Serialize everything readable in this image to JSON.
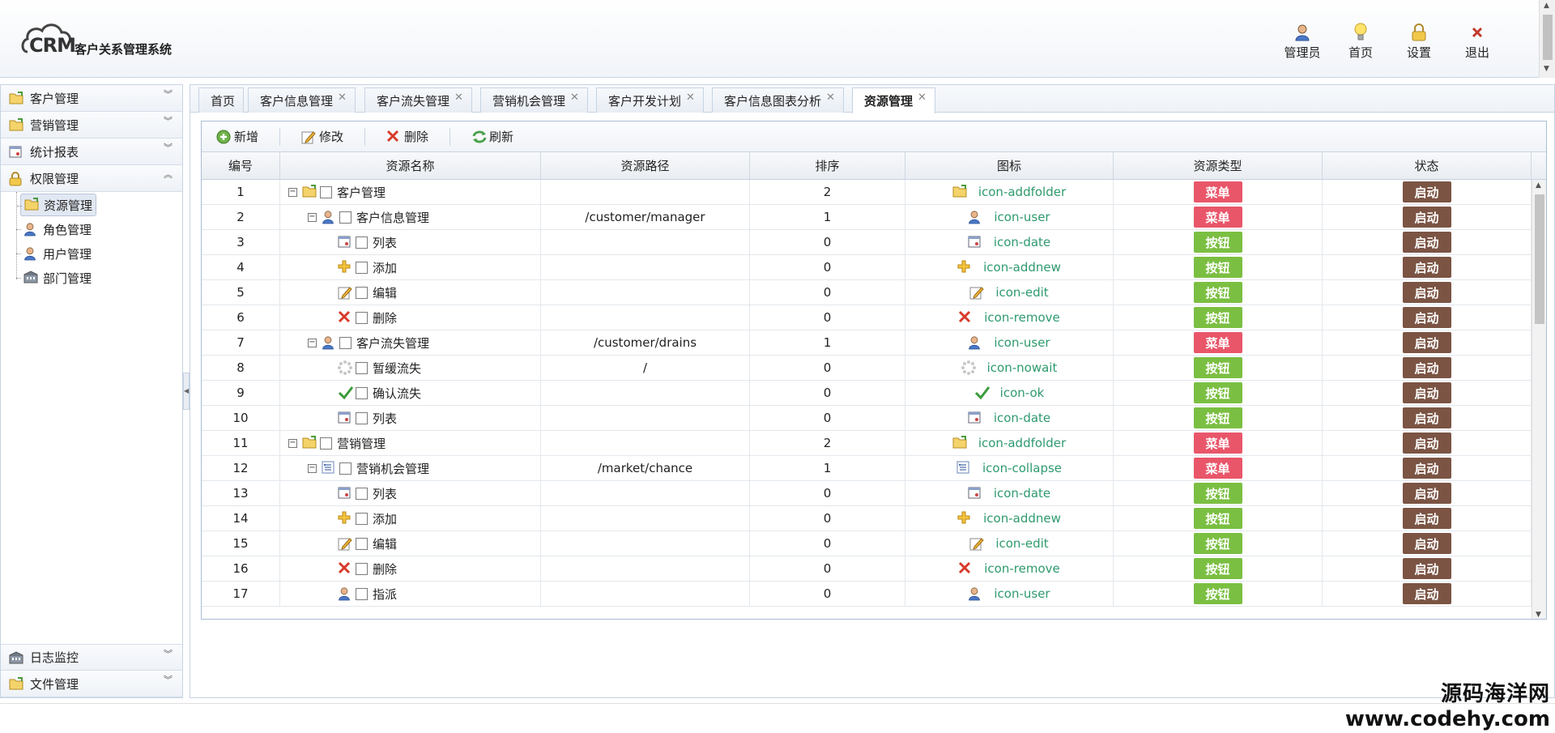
{
  "header": {
    "logo_text": "CRM",
    "title": "客户关系管理系统",
    "nav": [
      {
        "label": "管理员",
        "icon": "user-icon"
      },
      {
        "label": "首页",
        "icon": "lightbulb-icon"
      },
      {
        "label": "设置",
        "icon": "lock-icon"
      },
      {
        "label": "退出",
        "icon": "close-icon"
      }
    ]
  },
  "sidebar": {
    "sections": [
      {
        "label": "客户管理",
        "icon": "folder-icon"
      },
      {
        "label": "营销管理",
        "icon": "folder-icon"
      },
      {
        "label": "统计报表",
        "icon": "date-icon"
      },
      {
        "label": "权限管理",
        "icon": "lock-icon"
      }
    ],
    "sub_items": [
      {
        "label": "资源管理",
        "icon": "folder-icon"
      },
      {
        "label": "角色管理",
        "icon": "user-icon"
      },
      {
        "label": "用户管理",
        "icon": "user-icon"
      },
      {
        "label": "部门管理",
        "icon": "building-icon"
      }
    ],
    "bottom_sections": [
      {
        "label": "日志监控",
        "icon": "building-icon"
      },
      {
        "label": "文件管理",
        "icon": "folder-icon"
      }
    ]
  },
  "tabs": [
    {
      "label": "首页",
      "closable": false
    },
    {
      "label": "客户信息管理",
      "closable": true
    },
    {
      "label": "客户流失管理",
      "closable": true
    },
    {
      "label": "营销机会管理",
      "closable": true
    },
    {
      "label": "客户开发计划",
      "closable": true
    },
    {
      "label": "客户信息图表分析",
      "closable": true
    },
    {
      "label": "资源管理",
      "closable": true,
      "active": true
    }
  ],
  "toolbar": {
    "add": "新增",
    "edit": "修改",
    "delete": "删除",
    "refresh": "刷新"
  },
  "table": {
    "columns": [
      "编号",
      "资源名称",
      "资源路径",
      "排序",
      "图标",
      "资源类型",
      "状态"
    ],
    "rows": [
      {
        "id": "1",
        "name": "客户管理",
        "level": 0,
        "toggle": "⊟",
        "icon": "addfolder",
        "path": "",
        "sort": "2",
        "icon_name": "icon-addfolder",
        "type": "菜单",
        "status": "启动"
      },
      {
        "id": "2",
        "name": "客户信息管理",
        "level": 1,
        "toggle": "⊟",
        "icon": "user",
        "path": "/customer/manager",
        "sort": "1",
        "icon_name": "icon-user",
        "type": "菜单",
        "status": "启动"
      },
      {
        "id": "3",
        "name": "列表",
        "level": 2,
        "toggle": "",
        "icon": "date",
        "path": "",
        "sort": "0",
        "icon_name": "icon-date",
        "type": "按钮",
        "status": "启动"
      },
      {
        "id": "4",
        "name": "添加",
        "level": 2,
        "toggle": "",
        "icon": "addnew",
        "path": "",
        "sort": "0",
        "icon_name": "icon-addnew",
        "type": "按钮",
        "status": "启动"
      },
      {
        "id": "5",
        "name": "编辑",
        "level": 2,
        "toggle": "",
        "icon": "edit",
        "path": "",
        "sort": "0",
        "icon_name": "icon-edit",
        "type": "按钮",
        "status": "启动"
      },
      {
        "id": "6",
        "name": "删除",
        "level": 2,
        "toggle": "",
        "icon": "remove",
        "path": "",
        "sort": "0",
        "icon_name": "icon-remove",
        "type": "按钮",
        "status": "启动"
      },
      {
        "id": "7",
        "name": "客户流失管理",
        "level": 1,
        "toggle": "⊟",
        "icon": "user",
        "path": "/customer/drains",
        "sort": "1",
        "icon_name": "icon-user",
        "type": "菜单",
        "status": "启动"
      },
      {
        "id": "8",
        "name": "暂缓流失",
        "level": 2,
        "toggle": "",
        "icon": "nowait",
        "path": "/",
        "sort": "0",
        "icon_name": "icon-nowait",
        "type": "按钮",
        "status": "启动"
      },
      {
        "id": "9",
        "name": "确认流失",
        "level": 2,
        "toggle": "",
        "icon": "ok",
        "path": "",
        "sort": "0",
        "icon_name": "icon-ok",
        "type": "按钮",
        "status": "启动"
      },
      {
        "id": "10",
        "name": "列表",
        "level": 2,
        "toggle": "",
        "icon": "date",
        "path": "",
        "sort": "0",
        "icon_name": "icon-date",
        "type": "按钮",
        "status": "启动"
      },
      {
        "id": "11",
        "name": "营销管理",
        "level": 0,
        "toggle": "⊟",
        "icon": "addfolder",
        "path": "",
        "sort": "2",
        "icon_name": "icon-addfolder",
        "type": "菜单",
        "status": "启动"
      },
      {
        "id": "12",
        "name": "营销机会管理",
        "level": 1,
        "toggle": "⊟",
        "icon": "collapse",
        "path": "/market/chance",
        "sort": "1",
        "icon_name": "icon-collapse",
        "type": "菜单",
        "status": "启动"
      },
      {
        "id": "13",
        "name": "列表",
        "level": 2,
        "toggle": "",
        "icon": "date",
        "path": "",
        "sort": "0",
        "icon_name": "icon-date",
        "type": "按钮",
        "status": "启动"
      },
      {
        "id": "14",
        "name": "添加",
        "level": 2,
        "toggle": "",
        "icon": "addnew",
        "path": "",
        "sort": "0",
        "icon_name": "icon-addnew",
        "type": "按钮",
        "status": "启动"
      },
      {
        "id": "15",
        "name": "编辑",
        "level": 2,
        "toggle": "",
        "icon": "edit",
        "path": "",
        "sort": "0",
        "icon_name": "icon-edit",
        "type": "按钮",
        "status": "启动"
      },
      {
        "id": "16",
        "name": "删除",
        "level": 2,
        "toggle": "",
        "icon": "remove",
        "path": "",
        "sort": "0",
        "icon_name": "icon-remove",
        "type": "按钮",
        "status": "启动"
      },
      {
        "id": "17",
        "name": "指派",
        "level": 2,
        "toggle": "",
        "icon": "user",
        "path": "",
        "sort": "0",
        "icon_name": "icon-user",
        "type": "按钮",
        "status": "启动"
      }
    ]
  },
  "watermark": {
    "line1": "源码海洋网",
    "line2": "www.codehy.com"
  },
  "colors": {
    "menu_badge": "#e9566a",
    "button_badge": "#7bbf42",
    "status_badge": "#7b5444",
    "icon_text": "#2e9a6e"
  }
}
